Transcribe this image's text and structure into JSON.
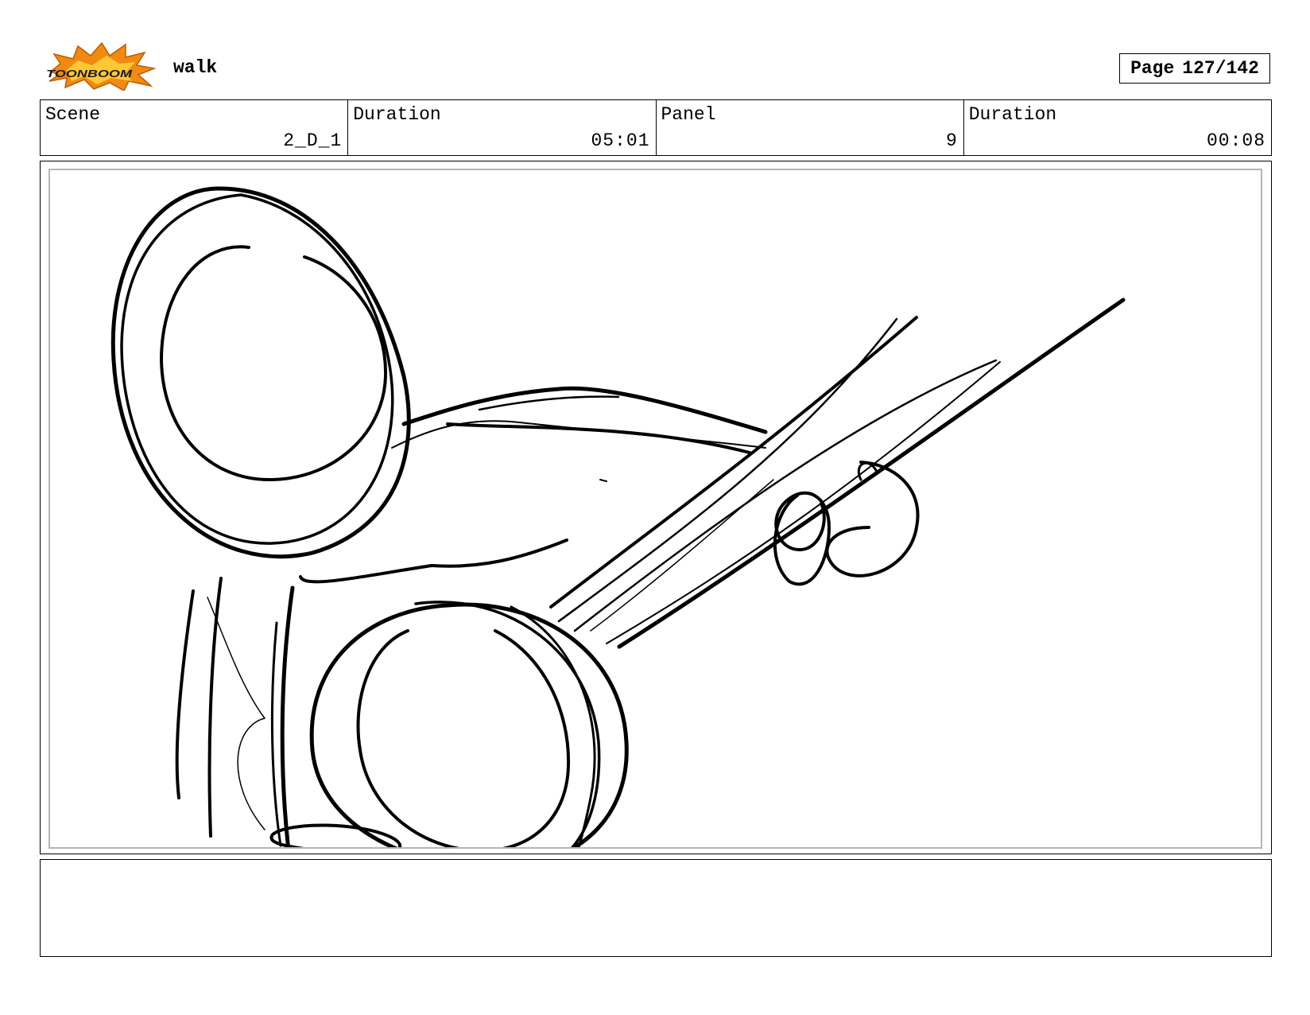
{
  "header": {
    "logo_text": "TOONBOOM",
    "project_title": "walk",
    "page_label": "Page",
    "page_number": "127/142"
  },
  "info": {
    "scene_label": "Scene",
    "scene_value": "2_D_1",
    "scene_duration_label": "Duration",
    "scene_duration_value": "05:01",
    "panel_label": "Panel",
    "panel_value": "9",
    "panel_duration_label": "Duration",
    "panel_duration_value": "00:08"
  },
  "panel": {
    "sketch_icon": "rough-pencil-sketch"
  },
  "notes": {
    "text": ""
  }
}
